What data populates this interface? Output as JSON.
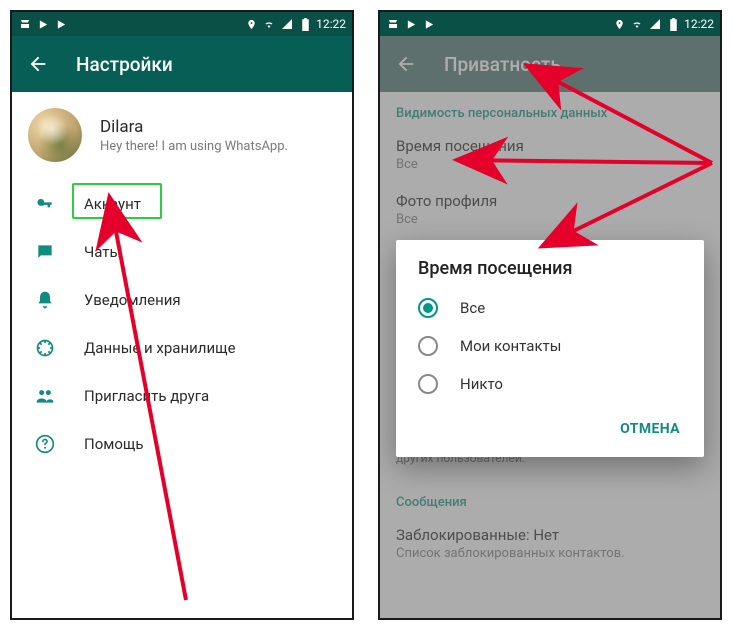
{
  "status": {
    "time": "12:22",
    "icons_left": [
      "shop-icon",
      "play-icon",
      "play-icon"
    ],
    "icons_right": [
      "location-icon",
      "wifi-icon",
      "signal-icon",
      "battery-icon"
    ]
  },
  "left": {
    "header_title": "Настройки",
    "profile": {
      "name": "Dilara",
      "status": "Hey there! I am using WhatsApp."
    },
    "items": [
      {
        "icon": "key-icon",
        "label": "Аккаунт",
        "highlight": true
      },
      {
        "icon": "chat-icon",
        "label": "Чаты"
      },
      {
        "icon": "bell-icon",
        "label": "Уведомления"
      },
      {
        "icon": "data-icon",
        "label": "Данные и хранилище"
      },
      {
        "icon": "people-icon",
        "label": "Пригласить друга"
      },
      {
        "icon": "help-icon",
        "label": "Помощь"
      }
    ]
  },
  "right": {
    "header_title": "Приватность",
    "section1_label": "Видимость персональных данных",
    "pref1": {
      "title": "Время посещения",
      "value": "Все"
    },
    "pref2": {
      "title": "Фото профиля",
      "value": "Все"
    },
    "info_text": "...вы скроете время своего последнего посещения, то не сможете видеть время последнего посещения других пользователей.",
    "section2_label": "Сообщения",
    "pref3": {
      "title": "Заблокированные: Нет",
      "value": "Список заблокированных контактов."
    },
    "dialog": {
      "title": "Время посещения",
      "options": [
        "Все",
        "Мои контакты",
        "Никто"
      ],
      "selected": "Все",
      "cancel": "ОТМЕНА"
    }
  }
}
